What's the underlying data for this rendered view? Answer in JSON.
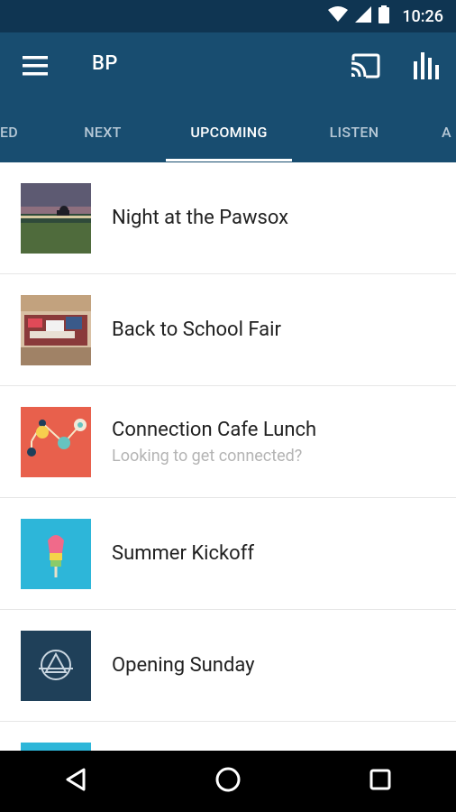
{
  "status_bar": {
    "time": "10:26",
    "icons": [
      "wifi-icon",
      "cell-signal-icon",
      "battery-icon"
    ]
  },
  "app_bar": {
    "title": "BP",
    "icons": [
      "menu-icon",
      "cast-icon",
      "bar-chart-icon"
    ]
  },
  "tabs": [
    {
      "label": "ED",
      "active": false
    },
    {
      "label": "NEXT",
      "active": false
    },
    {
      "label": "UPCOMING",
      "active": true
    },
    {
      "label": "LISTEN",
      "active": false
    },
    {
      "label": "A",
      "active": false
    }
  ],
  "events": [
    {
      "title": "Night at the Pawsox",
      "subtitle": ""
    },
    {
      "title": "Back to School Fair",
      "subtitle": ""
    },
    {
      "title": "Connection Cafe Lunch",
      "subtitle": "Looking to get connected?"
    },
    {
      "title": "Summer Kickoff",
      "subtitle": ""
    },
    {
      "title": "Opening Sunday",
      "subtitle": ""
    }
  ],
  "colors": {
    "status_bar": "#0f3552",
    "app_bar": "#184d70",
    "tab_inactive_text": "#b6c8d6",
    "cafe_thumb": "#e8604c",
    "summer_thumb": "#2db6d9",
    "opening_thumb": "#1d3c55"
  },
  "nav_bar": {
    "icons": [
      "back-icon",
      "home-icon",
      "recents-icon"
    ]
  }
}
